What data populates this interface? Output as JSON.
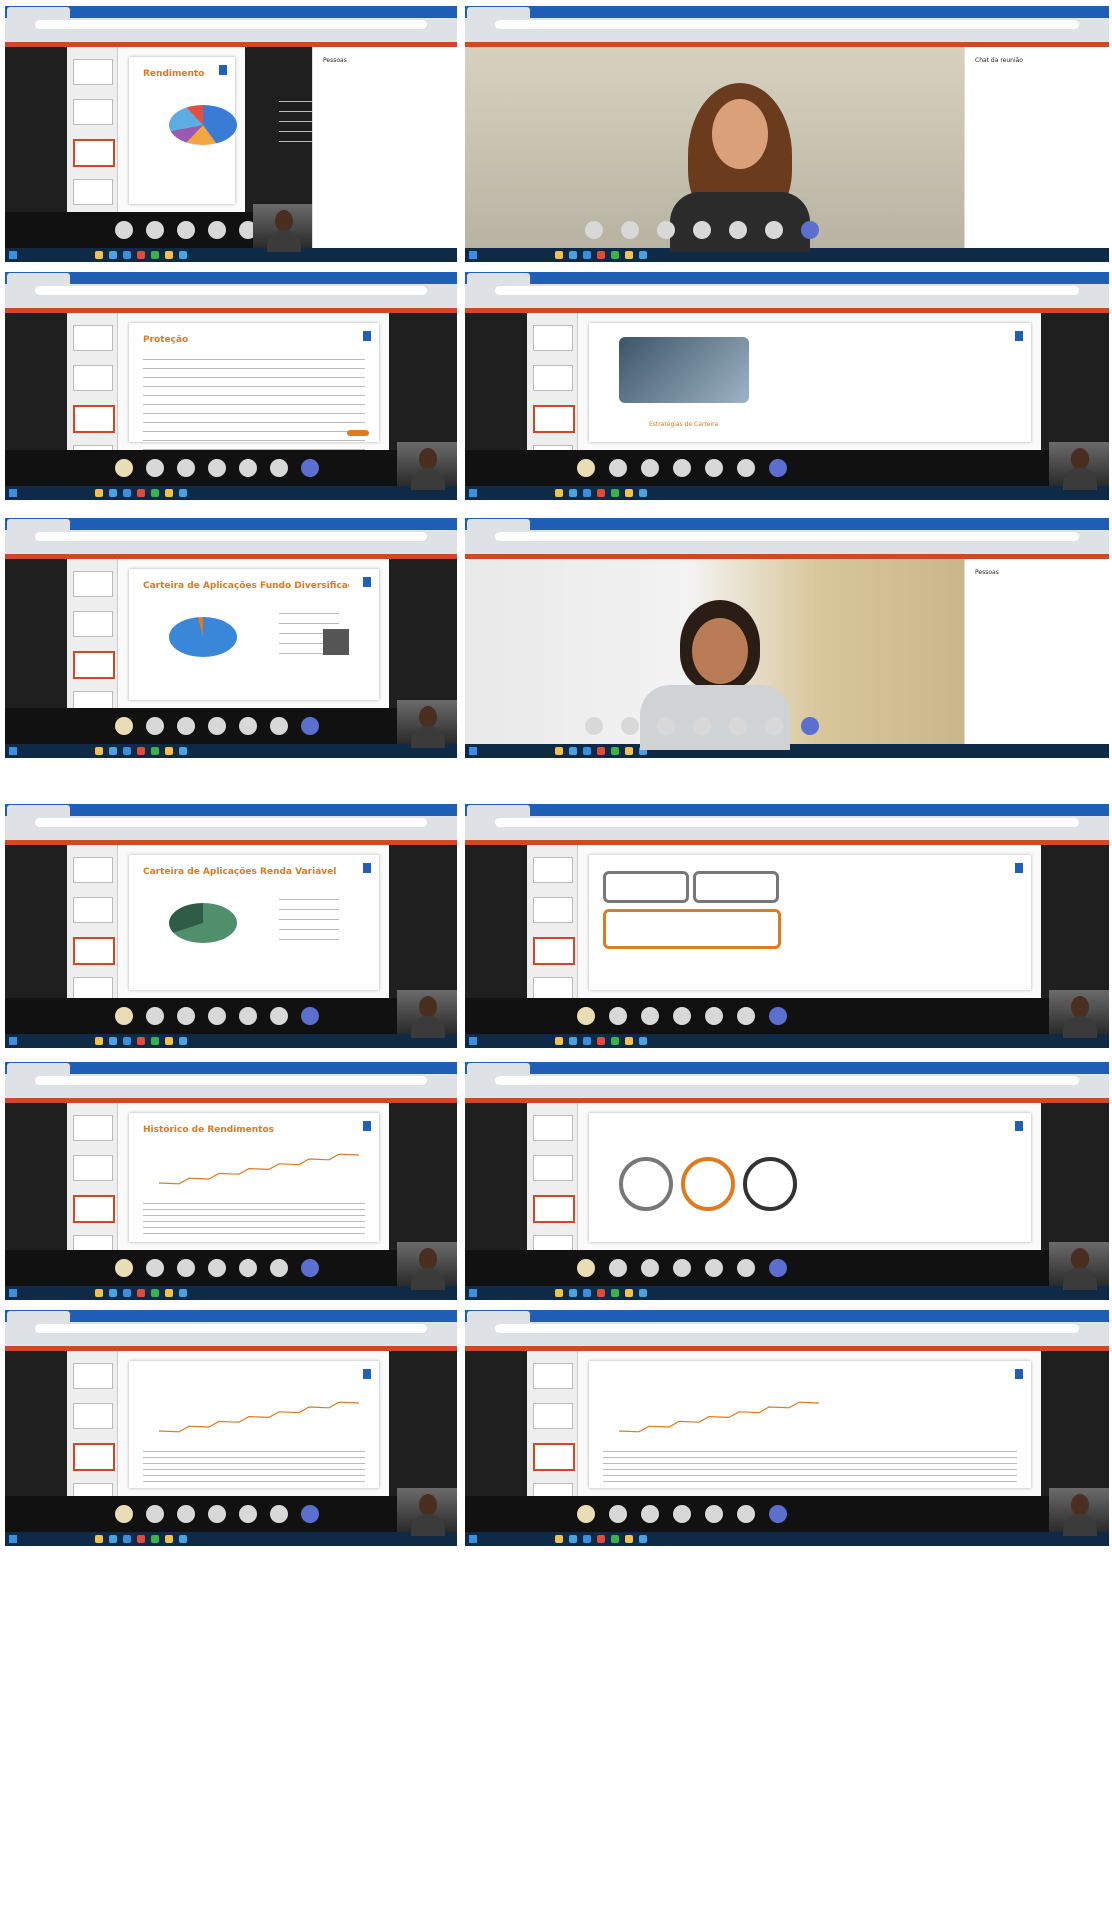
{
  "panels": [
    {
      "id": "p1",
      "slide_title": "Rendimentos Renda Fixa",
      "side_panel": "Pessoas",
      "type": "slides-pie"
    },
    {
      "id": "p2",
      "side_panel": "Chat da reunião",
      "type": "camera"
    },
    {
      "id": "p3",
      "slide_title": "Proteção",
      "type": "slides-table"
    },
    {
      "id": "p4",
      "type": "slides-diagram",
      "caption": "Estratégias de Carteira"
    },
    {
      "id": "p5",
      "slide_title": "Carteira de Aplicações Fundo Diversificação",
      "type": "slides-pie"
    },
    {
      "id": "p6",
      "side_panel": "Pessoas",
      "type": "camera"
    },
    {
      "id": "p7",
      "slide_title": "Carteira de Aplicações Renda Variável",
      "type": "slides-pie"
    },
    {
      "id": "p8",
      "type": "slides-boxes"
    },
    {
      "id": "p9",
      "slide_title": "Histórico de Rendimentos",
      "type": "slides-line"
    },
    {
      "id": "p10",
      "type": "slides-rings"
    },
    {
      "id": "p11",
      "type": "slides-line"
    },
    {
      "id": "p12",
      "type": "slides-line"
    }
  ],
  "colors": {
    "accent": "#d24726",
    "orange": "#e07a1f",
    "browser_tab_bar": "#1f5fb6",
    "taskbar": "#0e2a47"
  },
  "icons": [
    "microphone-icon",
    "camera-icon",
    "share-screen-icon",
    "hand-icon",
    "chat-icon",
    "people-icon",
    "end-call-icon"
  ]
}
